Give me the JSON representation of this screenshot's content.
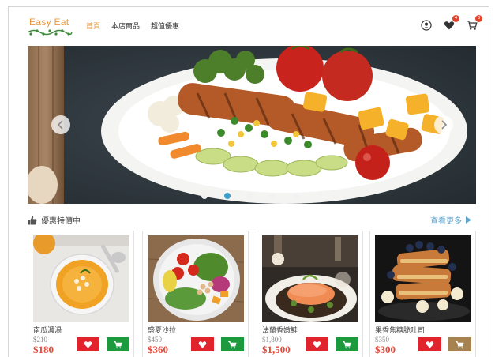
{
  "header": {
    "logo_text": "Easy Eat",
    "nav": [
      {
        "label": "首頁",
        "active": true
      },
      {
        "label": "本店商品",
        "active": false
      },
      {
        "label": "超值優惠",
        "active": false
      }
    ],
    "icons": [
      "user-icon",
      "heart-icon",
      "cart-icon"
    ],
    "wishlist_count": "4",
    "cart_count": "3"
  },
  "carousel": {
    "slide_count": 5,
    "active_index": 1
  },
  "section": {
    "title": "優惠特價中",
    "see_more": "查看更多"
  },
  "products": [
    {
      "name": "南瓜濃湯",
      "old_price": "$210",
      "price": "$180"
    },
    {
      "name": "盛夏沙拉",
      "old_price": "$450",
      "price": "$360"
    },
    {
      "name": "法蘭香嫩鮭",
      "old_price": "$1,800",
      "price": "$1,500"
    },
    {
      "name": "果香焦糖脆吐司",
      "old_price": "$350",
      "price": "$300"
    }
  ],
  "colors": {
    "accent": "#e89a43",
    "link": "#5fa6cf",
    "favorite": "#e0232d",
    "cart": "#1e9a3e",
    "cart_in": "#a5824f",
    "price": "#e14b3b",
    "dot_active": "#3c9fc9"
  }
}
